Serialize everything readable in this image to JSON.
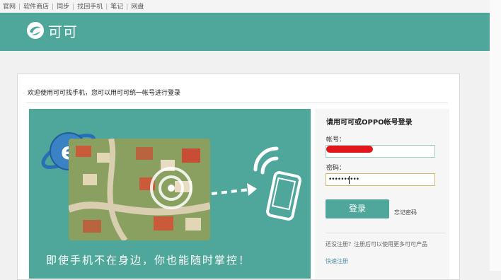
{
  "topnav": {
    "links": [
      "官网",
      "软件商店",
      "同步",
      "找回手机",
      "笔记",
      "网盘"
    ]
  },
  "header": {
    "logo_text": "可可",
    "color": "#4fa79b"
  },
  "panel": {
    "welcome": "欢迎使用可可找手机，您可以用可可统一帐号进行登录"
  },
  "banner": {
    "caption": "即使手机不在身边，你也能随时掌控！"
  },
  "login": {
    "title": "请用可可或OPPO帐号登录",
    "account_label": "帐号：",
    "account_value": "",
    "password_label": "密码：",
    "password_value": "••••••••••",
    "submit_label": "登录",
    "forgot_label": "忘记密码",
    "register_hint": "还没注册？注册后可以使用更多可可产品",
    "register_link": "快速注册"
  },
  "colors": {
    "accent": "#4fa79b",
    "redaction": "#e3161b"
  }
}
